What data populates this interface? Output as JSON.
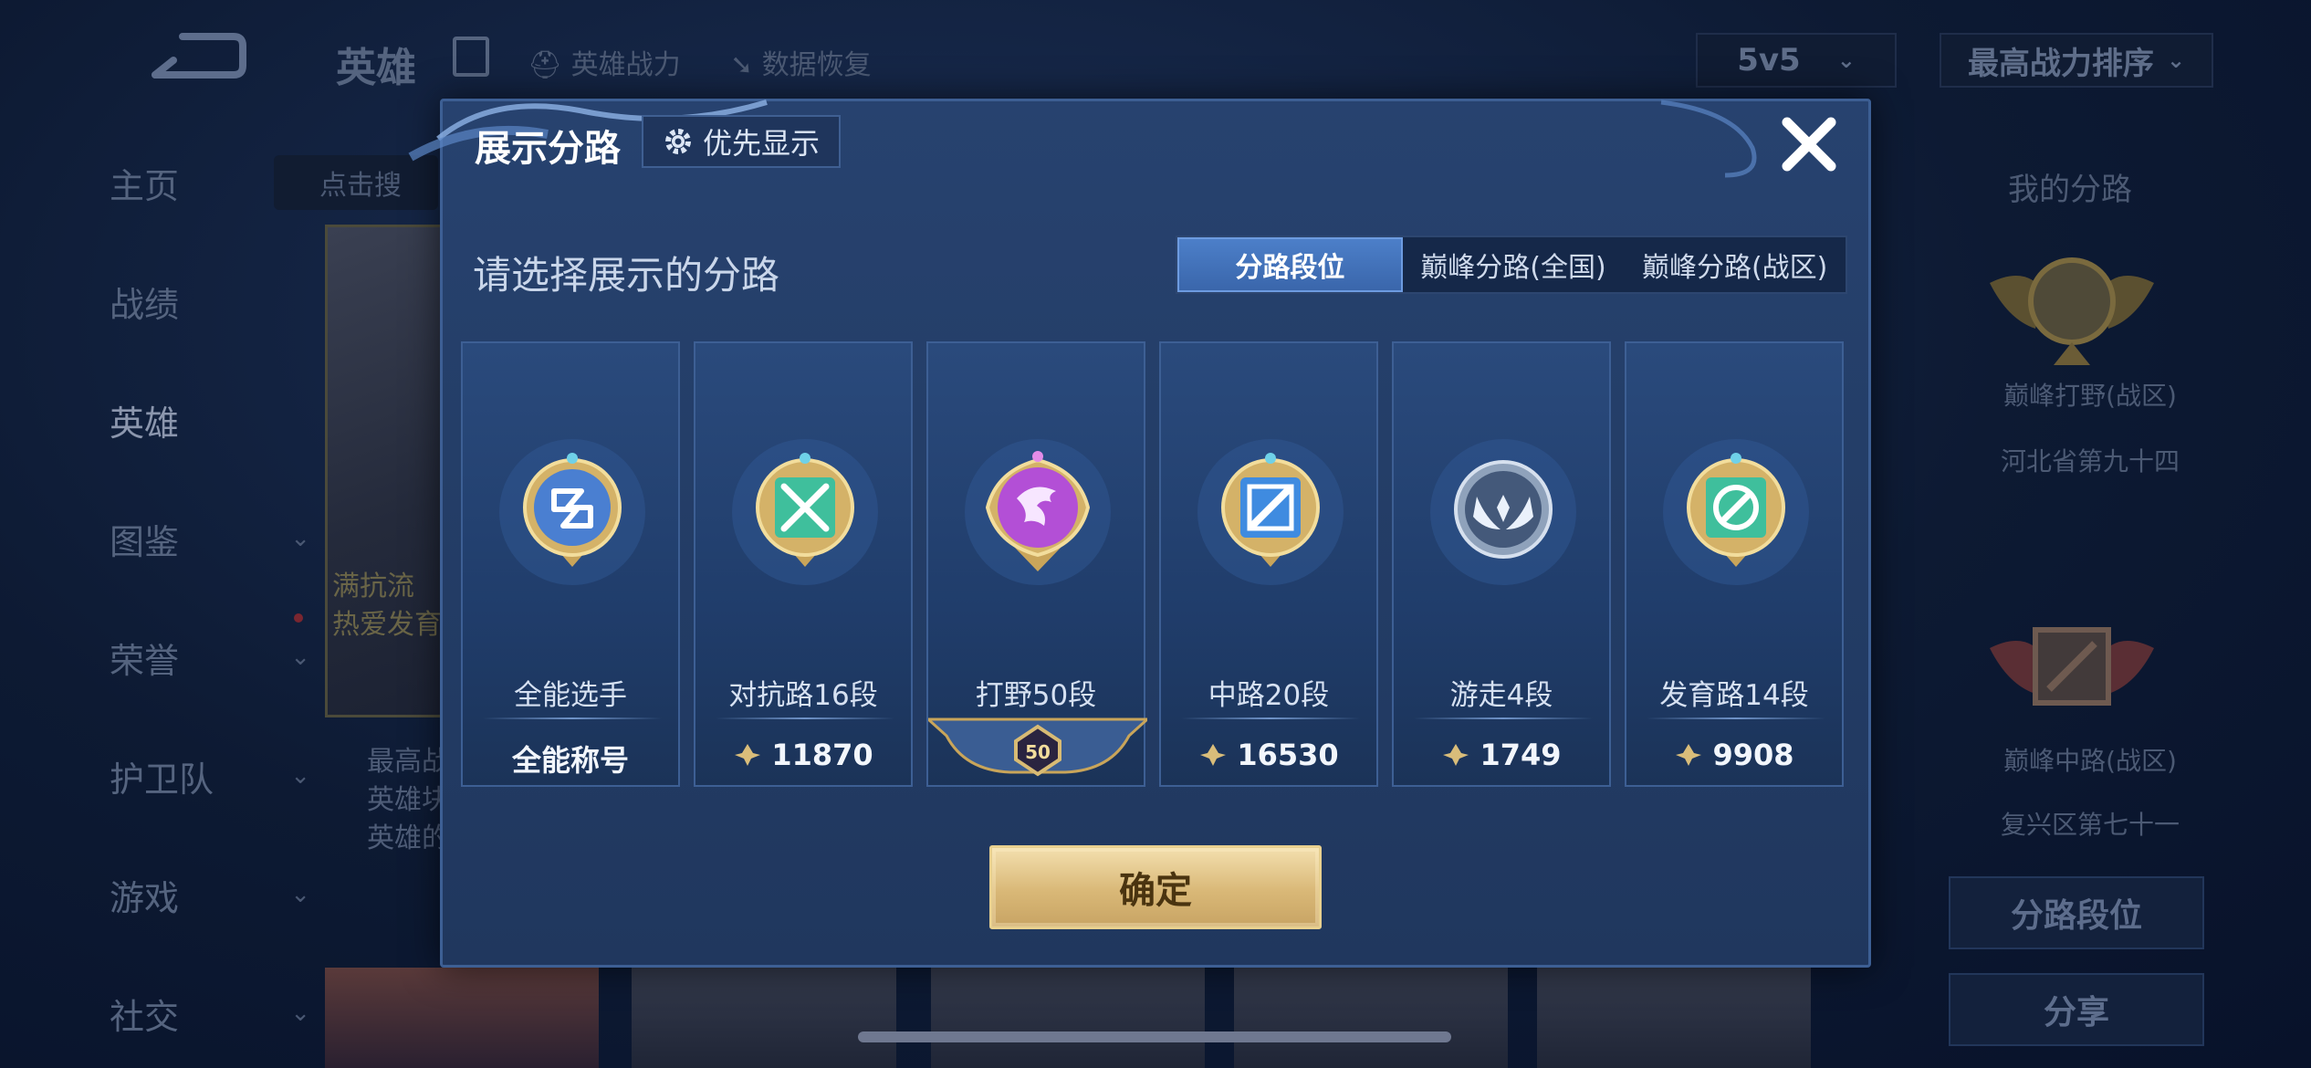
{
  "background": {
    "title": "英雄",
    "tabs": [
      {
        "label": "英雄战力"
      },
      {
        "label": "数据恢复"
      }
    ],
    "mode_select": "5v5",
    "sort_select": "最高战力排序",
    "search_placeholder": "点击搜",
    "nav": [
      {
        "label": "主页"
      },
      {
        "label": "战绩"
      },
      {
        "label": "英雄"
      },
      {
        "label": "图鉴"
      },
      {
        "label": "荣誉"
      },
      {
        "label": "护卫队"
      },
      {
        "label": "游戏"
      },
      {
        "label": "社交"
      }
    ],
    "hero_card_lines": [
      "最高战",
      "英雄块",
      "英雄的"
    ],
    "hero_card_overlay": [
      "满抗流",
      "热爱发育"
    ],
    "right_panel": {
      "title": "我的分路",
      "lane1_name": "巅峰打野(战区)",
      "lane1_rank": "河北省第九十四",
      "lane2_name": "巅峰中路(战区)",
      "lane2_rank": "复兴区第七十一",
      "btn_lane_rank": "分路段位",
      "btn_share": "分享"
    }
  },
  "modal": {
    "title": "展示分路",
    "priority_button": "优先显示",
    "subtitle": "请选择展示的分路",
    "segment_tabs": [
      {
        "label": "分路段位",
        "active": true
      },
      {
        "label": "巅峰分路(全国)",
        "active": false
      },
      {
        "label": "巅峰分路(战区)",
        "active": false
      }
    ],
    "lanes": [
      {
        "name": "全能选手",
        "value": "全能称号",
        "emblem": "all-round-emblem",
        "color": "#4a7fd1"
      },
      {
        "name": "对抗路16段",
        "value": "11870",
        "emblem": "clash-lane-emblem",
        "color": "#3fbf9c"
      },
      {
        "name": "打野50段",
        "value": "50",
        "emblem": "jungle-dragon-emblem",
        "color": "#b34fd6"
      },
      {
        "name": "中路20段",
        "value": "16530",
        "emblem": "mid-lane-emblem",
        "color": "#3f8be0"
      },
      {
        "name": "游走4段",
        "value": "1749",
        "emblem": "roam-wing-emblem",
        "color": "#9fb3cc"
      },
      {
        "name": "发育路14段",
        "value": "9908",
        "emblem": "farm-lane-emblem",
        "color": "#3fbf9c"
      }
    ],
    "confirm_button": "确定"
  },
  "colors": {
    "modal_bg": "#243e68",
    "accent_blue": "#4c7fc9",
    "gold": "#d9b877"
  }
}
